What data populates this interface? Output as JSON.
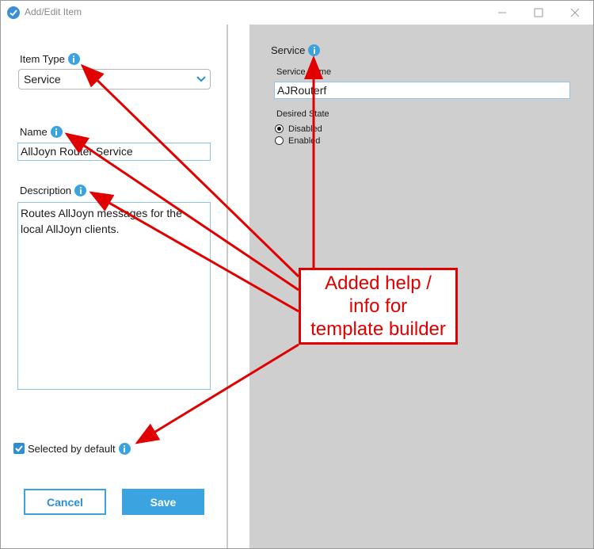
{
  "window": {
    "title": "Add/Edit Item"
  },
  "left": {
    "item_type": {
      "label": "Item Type",
      "value": "Service"
    },
    "name": {
      "label": "Name",
      "value": "AllJoyn Router Service"
    },
    "description": {
      "label": "Description",
      "value": "Routes AllJoyn messages for the\nlocal AllJoyn clients."
    },
    "selected_default": {
      "label": "Selected by default",
      "checked": true
    },
    "buttons": {
      "cancel": "Cancel",
      "save": "Save"
    }
  },
  "right": {
    "section_title": "Service",
    "service_name": {
      "label": "Service Name",
      "value": "AJRouterf"
    },
    "desired_state": {
      "label": "Desired State",
      "options": [
        "Disabled",
        "Enabled"
      ],
      "selected": "Disabled"
    }
  },
  "annotation": {
    "text_lines": [
      "Added help /",
      "info for",
      "template builder"
    ],
    "color": "#e00000"
  },
  "colors": {
    "accent": "#3ba3e0",
    "right_panel_bg": "#cfcfcf"
  }
}
